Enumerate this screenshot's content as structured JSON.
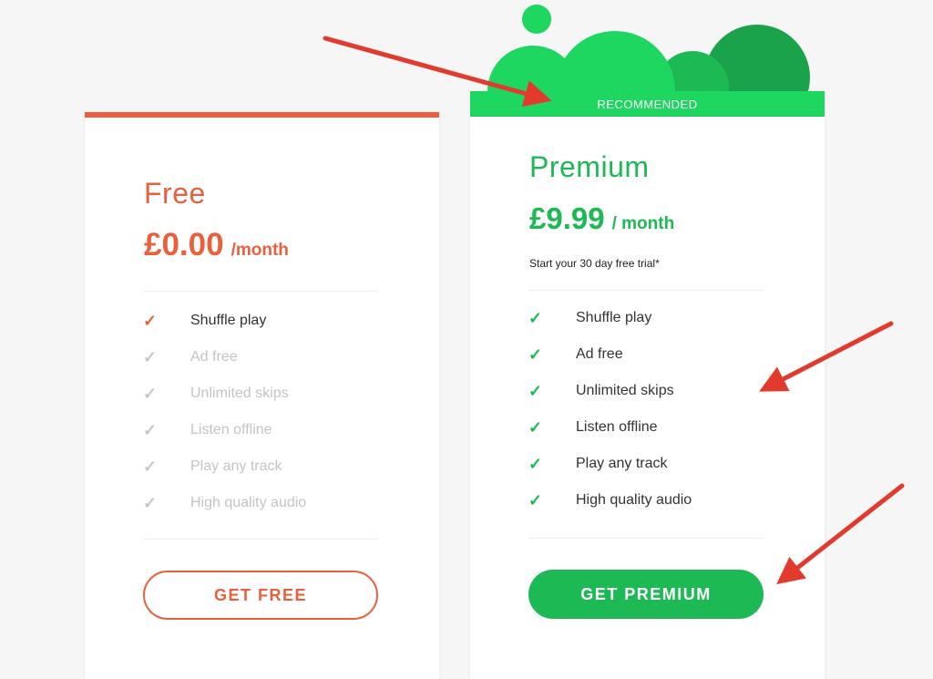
{
  "colors": {
    "free_accent": "#e8603c",
    "premium_accent": "#1db954",
    "ribbon": "#1ed760",
    "annotation_arrow": "#e23b2e"
  },
  "free": {
    "name": "Free",
    "price": "£0.00",
    "period": "/month",
    "features": [
      {
        "label": "Shuffle play",
        "included": true
      },
      {
        "label": "Ad free",
        "included": false
      },
      {
        "label": "Unlimited skips",
        "included": false
      },
      {
        "label": "Listen offline",
        "included": false
      },
      {
        "label": "Play any track",
        "included": false
      },
      {
        "label": "High quality audio",
        "included": false
      }
    ],
    "button_label": "GET FREE"
  },
  "premium": {
    "ribbon_label": "RECOMMENDED",
    "name": "Premium",
    "price": "£9.99",
    "period": "/ month",
    "subtitle": "Start your 30 day free trial*",
    "features": [
      {
        "label": "Shuffle play",
        "included": true
      },
      {
        "label": "Ad free",
        "included": true
      },
      {
        "label": "Unlimited skips",
        "included": true
      },
      {
        "label": "Listen offline",
        "included": true
      },
      {
        "label": "Play any track",
        "included": true
      },
      {
        "label": "High quality audio",
        "included": true
      }
    ],
    "button_label": "GET PREMIUM"
  },
  "icons": {
    "feature_check": "check-icon",
    "annotation": "arrow-icon"
  }
}
